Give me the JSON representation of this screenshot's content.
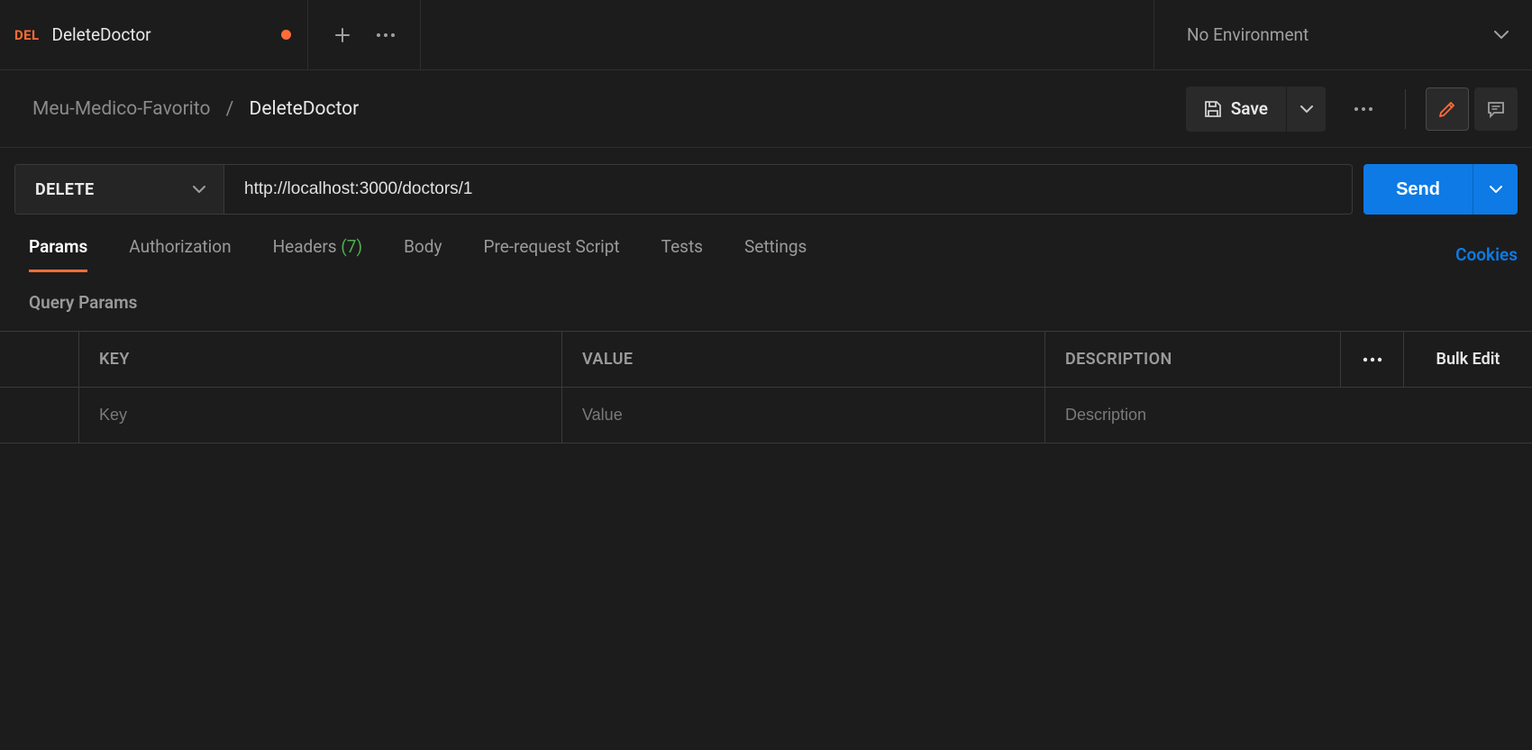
{
  "tab": {
    "method_badge": "DEL",
    "title": "DeleteDoctor"
  },
  "environment": {
    "label": "No Environment"
  },
  "breadcrumb": {
    "collection": "Meu-Medico-Favorito",
    "sep": "/",
    "current": "DeleteDoctor"
  },
  "save": {
    "label": "Save"
  },
  "request": {
    "method": "DELETE",
    "url": "http://localhost:3000/doctors/1"
  },
  "send": {
    "label": "Send"
  },
  "subtabs": {
    "params": "Params",
    "authorization": "Authorization",
    "headers_label": "Headers",
    "headers_count": "(7)",
    "body": "Body",
    "prerequest": "Pre-request Script",
    "tests": "Tests",
    "settings": "Settings"
  },
  "cookies": "Cookies",
  "query_params_heading": "Query Params",
  "params_table": {
    "headers": {
      "key": "KEY",
      "value": "VALUE",
      "description": "DESCRIPTION",
      "bulk_edit": "Bulk Edit"
    },
    "row": {
      "key_placeholder": "Key",
      "value_placeholder": "Value",
      "description_placeholder": "Description"
    }
  }
}
